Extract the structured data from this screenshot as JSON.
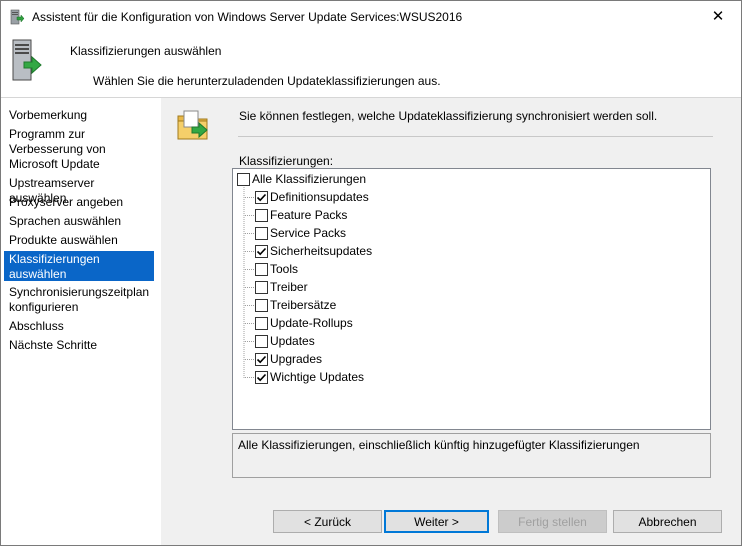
{
  "window": {
    "title": "Assistent für die Konfiguration von Windows Server Update Services:WSUS2016",
    "close_glyph": "✕"
  },
  "header": {
    "title": "Klassifizierungen auswählen",
    "description": "Wählen Sie die herunterzuladenden Updateklassifizierungen aus."
  },
  "nav": {
    "items": [
      {
        "label": "Vorbemerkung",
        "active": false
      },
      {
        "label": "Programm zur Verbesserung von Microsoft Update",
        "active": false
      },
      {
        "label": "Upstreamserver auswählen",
        "active": false
      },
      {
        "label": "Proxyserver angeben",
        "active": false
      },
      {
        "label": "Sprachen auswählen",
        "active": false
      },
      {
        "label": "Produkte auswählen",
        "active": false
      },
      {
        "label": "Klassifizierungen auswählen",
        "active": true
      },
      {
        "label": "Synchronisierungszeitplan konfigurieren",
        "active": false
      },
      {
        "label": "Abschluss",
        "active": false
      },
      {
        "label": "Nächste Schritte",
        "active": false
      }
    ],
    "active_color": "#0a66c8"
  },
  "content": {
    "intro": "Sie können festlegen, welche Updateklassifizierung synchronisiert werden soll.",
    "list_label": "Klassifizierungen:",
    "root": {
      "label": "Alle Klassifizierungen",
      "checked": false
    },
    "classifications": [
      {
        "label": "Definitionsupdates",
        "checked": true
      },
      {
        "label": "Feature Packs",
        "checked": false
      },
      {
        "label": "Service Packs",
        "checked": false
      },
      {
        "label": "Sicherheitsupdates",
        "checked": true
      },
      {
        "label": "Tools",
        "checked": false
      },
      {
        "label": "Treiber",
        "checked": false
      },
      {
        "label": "Treibersätze",
        "checked": false
      },
      {
        "label": "Update-Rollups",
        "checked": false
      },
      {
        "label": "Updates",
        "checked": false
      },
      {
        "label": "Upgrades",
        "checked": true
      },
      {
        "label": "Wichtige Updates",
        "checked": true
      }
    ],
    "description": "Alle Klassifizierungen, einschließlich künftig hinzugefügter Klassifizierungen"
  },
  "buttons": {
    "back": "< Zurück",
    "next": "Weiter >",
    "finish": "Fertig stellen",
    "cancel": "Abbrechen"
  }
}
